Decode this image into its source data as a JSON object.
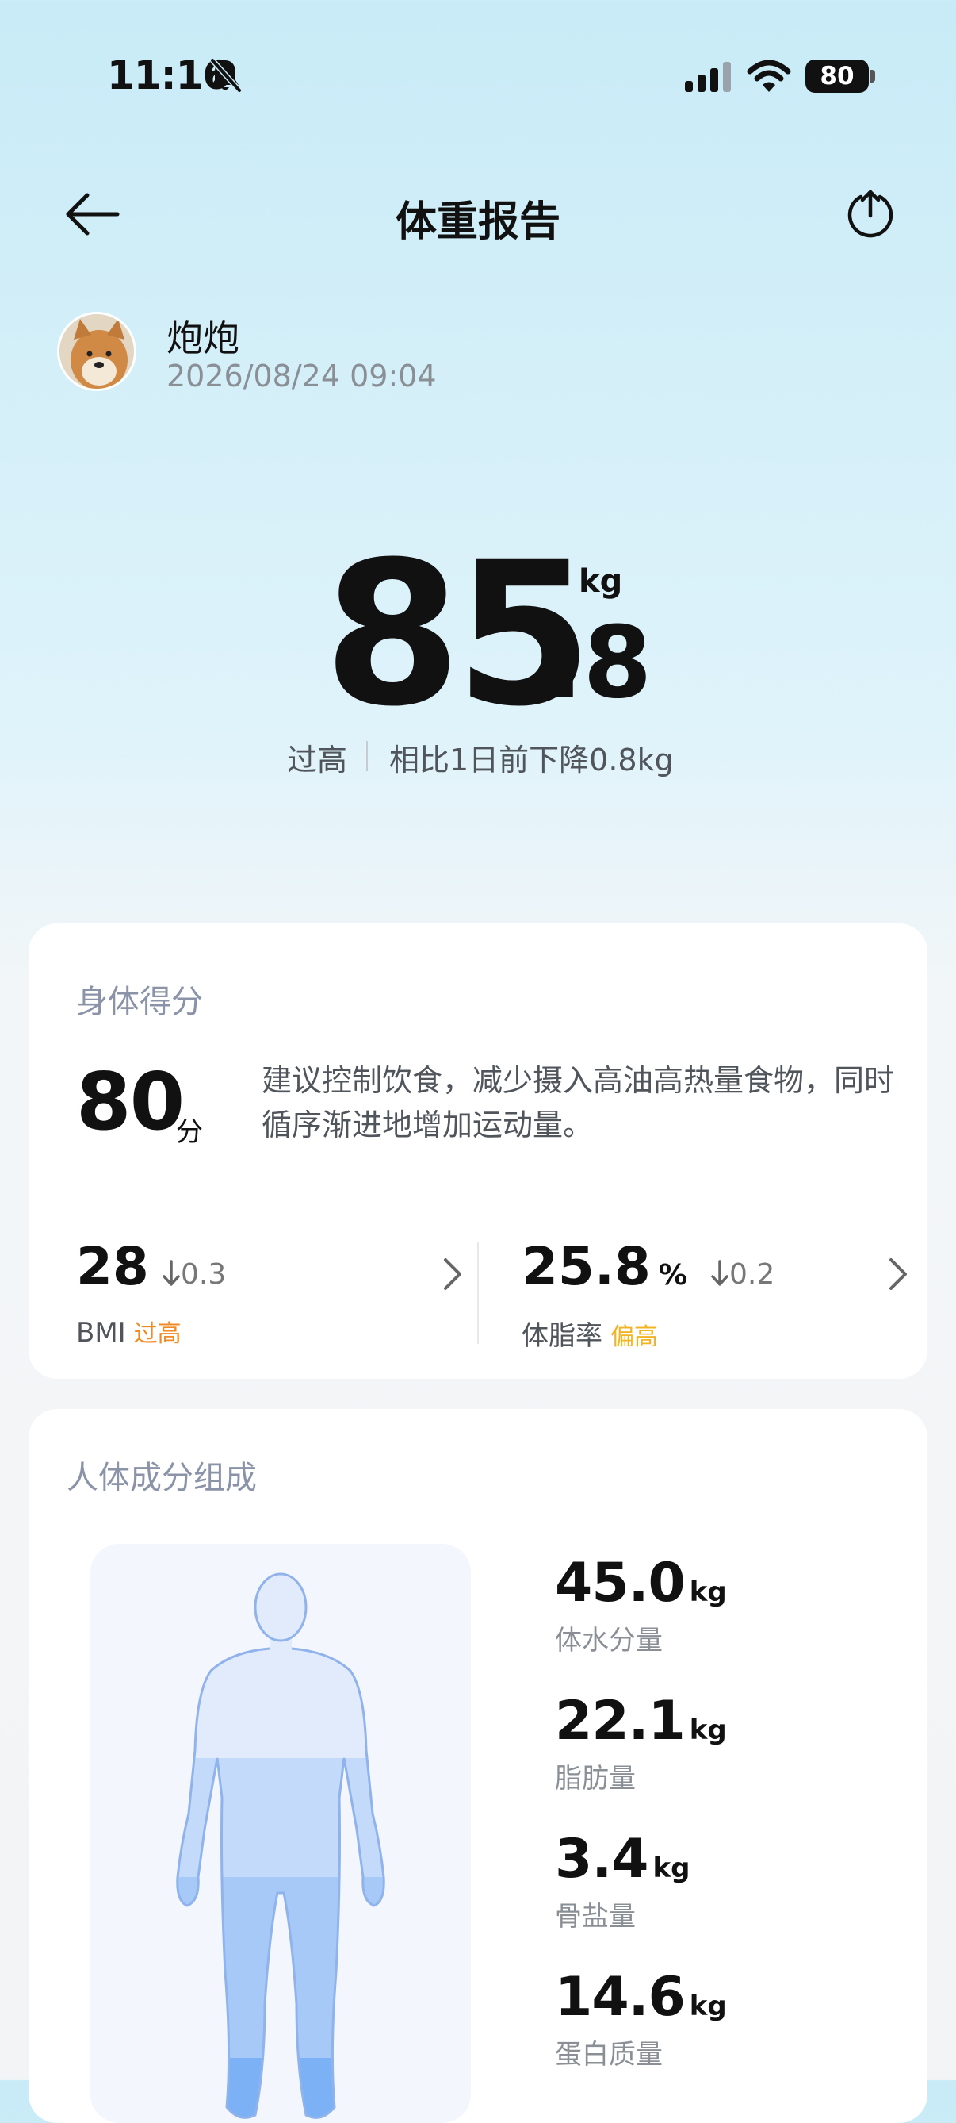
{
  "status_bar": {
    "time": "11:16",
    "battery": "80"
  },
  "header": {
    "title": "体重报告"
  },
  "user": {
    "name": "炮炮",
    "datetime": "2026/08/24 09:04"
  },
  "weight": {
    "integer": "85",
    "decimal": ".8",
    "unit": "kg",
    "status": "过高",
    "change": "相比1日前下降0.8kg"
  },
  "body_score": {
    "title": "身体得分",
    "score": "80",
    "score_unit": "分",
    "advice": "建议控制饮食，减少摄入高油高热量食物，同时循序渐进地增加运动量。",
    "bmi": {
      "value": "28",
      "delta": "0.3",
      "label": "BMI",
      "level": "过高",
      "level_color": "#f08a24"
    },
    "body_fat": {
      "value": "25.8",
      "unit": "%",
      "delta": "0.2",
      "label": "体脂率",
      "level": "偏高",
      "level_color": "#f2b423"
    }
  },
  "composition": {
    "title": "人体成分组成",
    "items": [
      {
        "value": "45.0",
        "unit": "kg",
        "label": "体水分量"
      },
      {
        "value": "22.1",
        "unit": "kg",
        "label": "脂肪量"
      },
      {
        "value": "3.4",
        "unit": "kg",
        "label": "骨盐量"
      },
      {
        "value": "14.6",
        "unit": "kg",
        "label": "蛋白质量"
      }
    ]
  },
  "icons": [
    "bell-off-icon",
    "signal-icon",
    "wifi-icon",
    "battery-icon",
    "back-arrow-icon",
    "share-icon",
    "arrow-down-icon",
    "chevron-right-icon",
    "body-figure"
  ]
}
